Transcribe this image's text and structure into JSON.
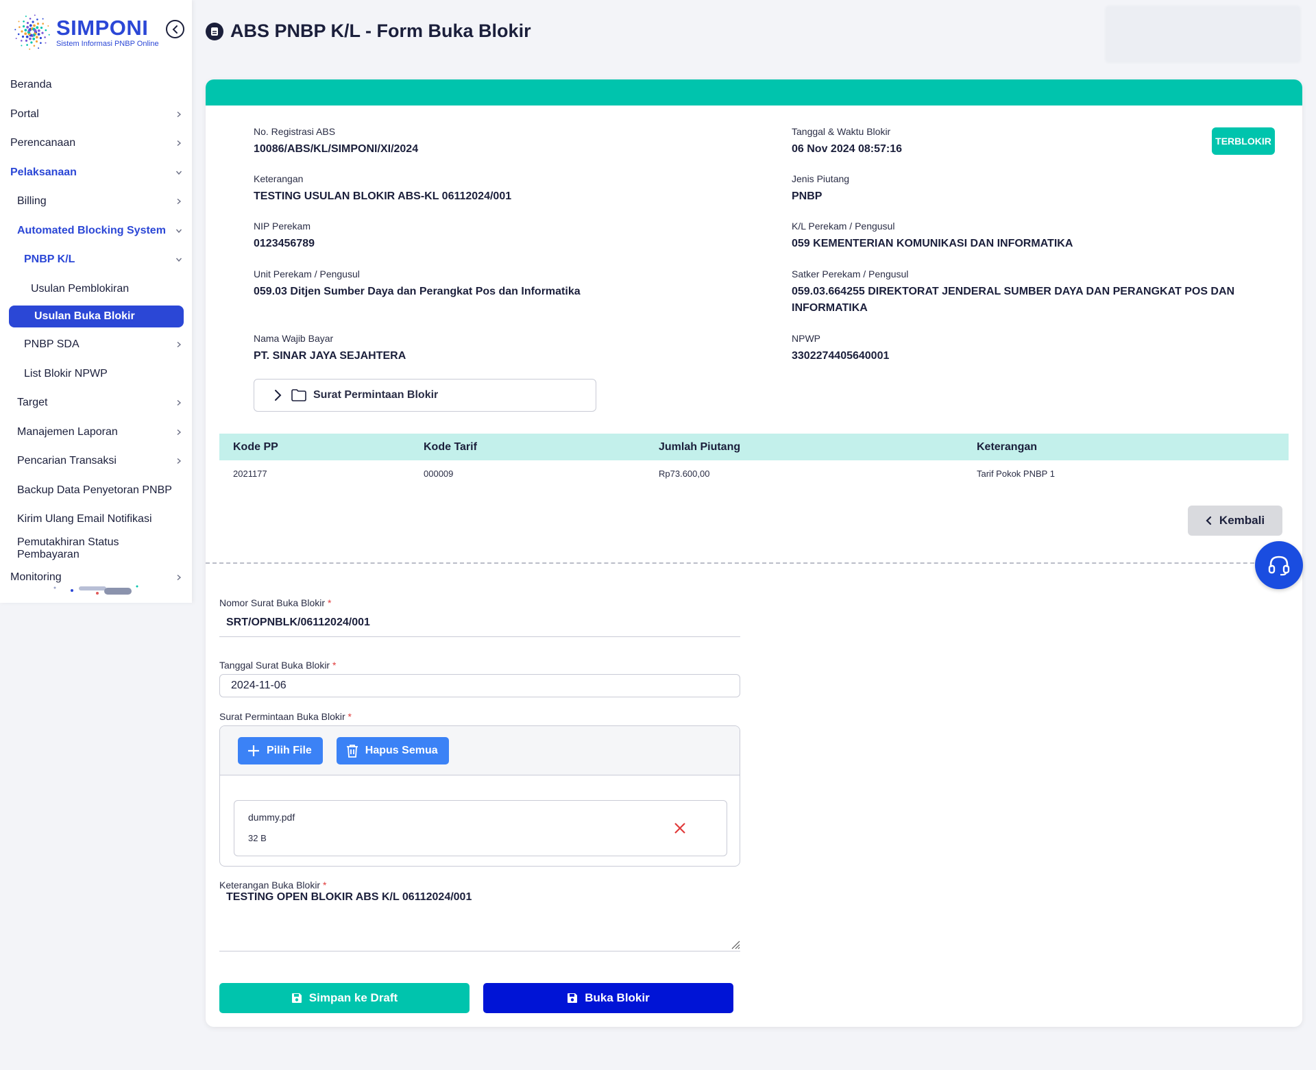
{
  "app": {
    "logo_title": "SIMPONI",
    "logo_subtitle": "Sistem Informasi PNBP Online",
    "page_title": "ABS PNBP K/L - Form Buka Blokir"
  },
  "colors": {
    "primary": "#2b47d6",
    "teal": "#00c4ad",
    "navy": "#0014d6",
    "upload_blue": "#3b82f6",
    "danger": "#e03b3b"
  },
  "sidebar": {
    "items": [
      {
        "label": "Beranda",
        "level": 0,
        "chevron": "none"
      },
      {
        "label": "Portal",
        "level": 0,
        "chevron": "right"
      },
      {
        "label": "Perencanaan",
        "level": 0,
        "chevron": "right"
      },
      {
        "label": "Pelaksanaan",
        "level": 0,
        "chevron": "down",
        "active": true
      },
      {
        "label": "Billing",
        "level": 1,
        "chevron": "right"
      },
      {
        "label": "Automated Blocking System",
        "level": 1,
        "chevron": "down",
        "active": true
      },
      {
        "label": "PNBP K/L",
        "level": 2,
        "chevron": "down",
        "active": true
      },
      {
        "label": "Usulan Pemblokiran",
        "level": 3,
        "chevron": "none"
      },
      {
        "label": "Usulan Buka Blokir",
        "level": 3,
        "chevron": "none",
        "selected": true
      },
      {
        "label": "PNBP SDA",
        "level": 2,
        "chevron": "right"
      },
      {
        "label": "List Blokir NPWP",
        "level": 2,
        "chevron": "none"
      },
      {
        "label": "Target",
        "level": 1,
        "chevron": "right"
      },
      {
        "label": "Manajemen Laporan",
        "level": 1,
        "chevron": "right"
      },
      {
        "label": "Pencarian Transaksi",
        "level": 1,
        "chevron": "right"
      },
      {
        "label": "Backup Data Penyetoran PNBP",
        "level": 1,
        "chevron": "none"
      },
      {
        "label": "Kirim Ulang Email Notifikasi",
        "level": 1,
        "chevron": "none"
      },
      {
        "label": "Pemutakhiran Status Pembayaran",
        "level": 1,
        "chevron": "none"
      },
      {
        "label": "Monitoring",
        "level": 0,
        "chevron": "right"
      }
    ]
  },
  "detail": {
    "status_badge": "TERBLOKIR",
    "no_registrasi_label": "No. Registrasi ABS",
    "no_registrasi": "10086/ABS/KL/SIMPONI/XI/2024",
    "tanggal_label": "Tanggal & Waktu Blokir",
    "tanggal": "06 Nov 2024 08:57:16",
    "keterangan_label": "Keterangan",
    "keterangan": "TESTING USULAN BLOKIR ABS-KL 06112024/001",
    "jenis_label": "Jenis Piutang",
    "jenis": "PNBP",
    "nip_label": "NIP Perekam",
    "nip": "0123456789",
    "kl_label": "K/L Perekam / Pengusul",
    "kl": "059 KEMENTERIAN KOMUNIKASI DAN INFORMATIKA",
    "unit_label": "Unit Perekam / Pengusul",
    "unit": "059.03 Ditjen Sumber Daya dan Perangkat Pos dan Informatika",
    "satker_label": "Satker Perekam / Pengusul",
    "satker": "059.03.664255 DIREKTORAT JENDERAL SUMBER DAYA DAN PERANGKAT POS DAN INFORMATIKA",
    "wajib_bayar_label": "Nama Wajib Bayar",
    "wajib_bayar": "PT. SINAR JAYA SEJAHTERA",
    "npwp_label": "NPWP",
    "npwp": "3302274405640001",
    "attachment_label": "Surat Permintaan Blokir"
  },
  "table": {
    "headers": [
      "Kode PP",
      "Kode Tarif",
      "Jumlah Piutang",
      "Keterangan"
    ],
    "rows": [
      [
        "2021177",
        "000009",
        "Rp73.600,00",
        "Tarif Pokok PNBP 1"
      ]
    ]
  },
  "back_button": "Kembali",
  "form": {
    "nomor_label": "Nomor Surat Buka Blokir",
    "nomor_value": "SRT/OPNBLK/06112024/001",
    "tanggal_label": "Tanggal Surat Buka Blokir",
    "tanggal_value": "2024-11-06",
    "surat_label": "Surat Permintaan Buka Blokir",
    "pilih_file": "Pilih File",
    "hapus_semua": "Hapus Semua",
    "file_name": "dummy.pdf",
    "file_size": "32 B",
    "keterangan_label": "Keterangan Buka Blokir",
    "keterangan_value": "TESTING OPEN BLOKIR ABS K/L 06112024/001",
    "required_mark": "*",
    "save_draft": "Simpan ke Draft",
    "buka_blokir": "Buka Blokir"
  }
}
